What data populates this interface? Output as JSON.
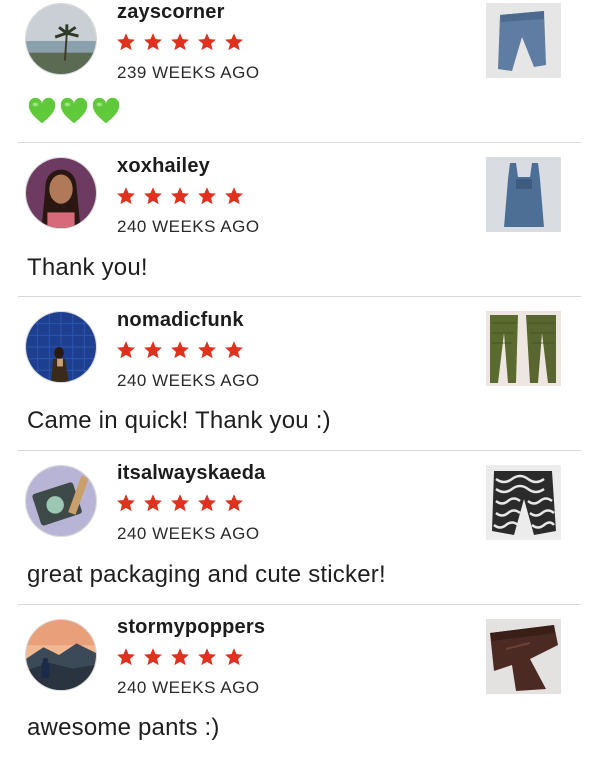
{
  "reviews": [
    {
      "username": "zayscorner",
      "rating": 5,
      "time": "239 WEEKS AGO",
      "comment": "",
      "emoji": "green-heart-x3"
    },
    {
      "username": "xoxhailey",
      "rating": 5,
      "time": "240 WEEKS AGO",
      "comment": "Thank you!"
    },
    {
      "username": "nomadicfunk",
      "rating": 5,
      "time": "240 WEEKS AGO",
      "comment": "Came in quick! Thank you :)"
    },
    {
      "username": "itsalwayskaeda",
      "rating": 5,
      "time": "240 WEEKS AGO",
      "comment": "great packaging and cute sticker!"
    },
    {
      "username": "stormypoppers",
      "rating": 5,
      "time": "240 WEEKS AGO",
      "comment": "awesome pants :)"
    }
  ],
  "colors": {
    "star": "#e0301e",
    "heart": "#5fc93a",
    "divider": "#d9d9d9"
  }
}
